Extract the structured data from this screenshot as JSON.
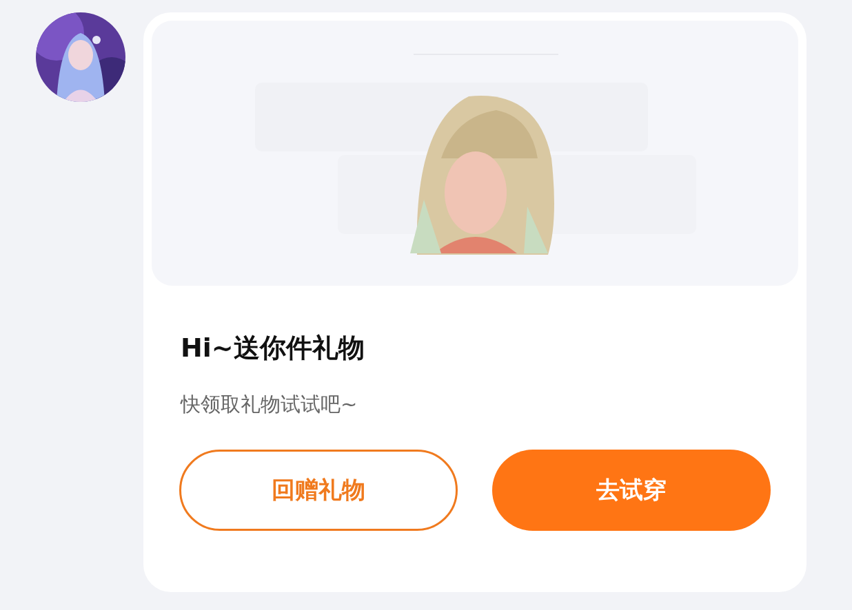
{
  "message": {
    "title": "Hi~送你件礼物",
    "subtitle": "快领取礼物试试吧~",
    "buttons": [
      {
        "label": "回赠礼物",
        "kind": "outline"
      },
      {
        "label": "去试穿",
        "kind": "filled"
      }
    ]
  }
}
